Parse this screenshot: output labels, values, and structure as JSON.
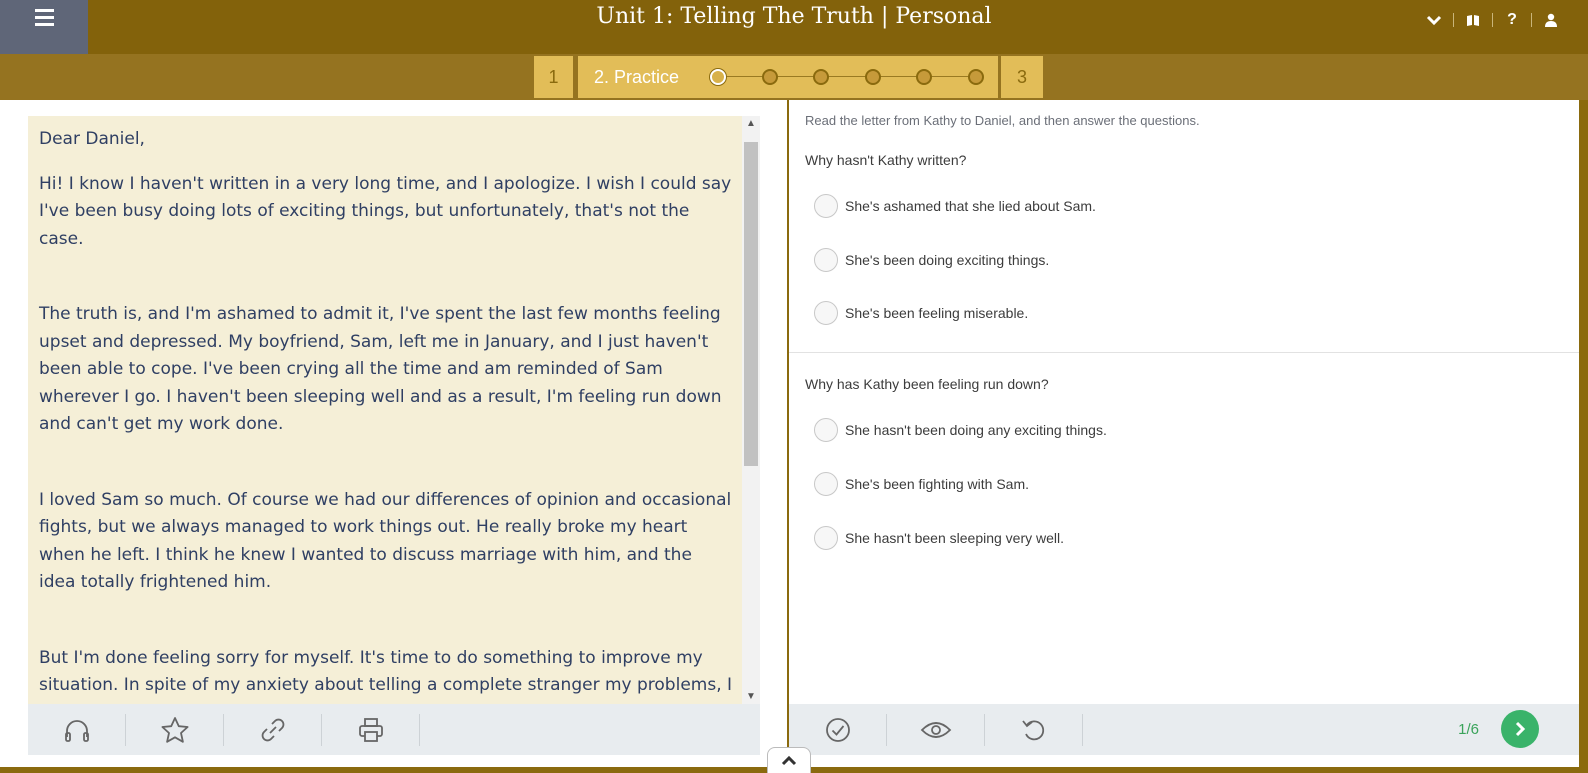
{
  "header": {
    "title": "Unit 1: Telling The Truth | Personal",
    "icons": [
      "menu-icon",
      "chevron-down-icon",
      "book-icon",
      "help-icon",
      "user-icon"
    ],
    "help_glyph": "?"
  },
  "stepper": {
    "step1": "1",
    "step2": "2. Practice",
    "step3": "3",
    "dots_total": 6,
    "active_dot": 1
  },
  "letter": {
    "greeting": "Dear Daniel,",
    "paragraphs": [
      "Hi! I know I haven't written in a very long time, and I apologize. I wish I could say I've been busy doing lots of exciting things, but unfortunately, that's not the case.",
      "The truth is, and I'm ashamed to admit it, I've spent the last few months feeling upset and depressed. My boyfriend, Sam, left me in January, and I just haven't been able to cope. I've been crying all the time and am reminded of Sam wherever I go. I haven't been sleeping well and as a result, I'm feeling run down and can't get my work done.",
      "I loved Sam so much. Of course we had our differences of opinion and occasional fights, but we always managed to work things out. He really broke my heart when he left. I think he knew I wanted to discuss marriage with him, and the idea totally frightened him.",
      "But I'm done feeling sorry for myself. It's time to do something to improve my situation. In spite of my anxiety about telling a complete stranger my problems, I want to see a therapist. I need someone who's sympathetic and kind. Do you have anyone to recommend? When you went for counseling a few years ago, did you find it helpful?"
    ]
  },
  "left_toolbar": [
    "headphones-icon",
    "star-icon",
    "link-icon",
    "print-icon"
  ],
  "exercise": {
    "instruction": "Read the letter from Kathy to Daniel, and then answer the questions.",
    "questions": [
      {
        "text": "Why hasn't Kathy written?",
        "options": [
          "She's ashamed that she lied about Sam.",
          "She's been doing exciting things.",
          "She's been feeling miserable."
        ]
      },
      {
        "text": "Why has Kathy been feeling run down?",
        "options": [
          "She hasn't been doing any exciting things.",
          "She's been fighting with Sam.",
          "She hasn't been sleeping very well."
        ]
      }
    ]
  },
  "right_toolbar": {
    "icons": [
      "check-icon",
      "eye-icon",
      "undo-icon"
    ],
    "page_count": "1/6"
  },
  "colors": {
    "header": "#83620b",
    "step_bg": "#e2bd58",
    "letter_bg": "#f5efd7",
    "next_button": "#3ab36a"
  }
}
